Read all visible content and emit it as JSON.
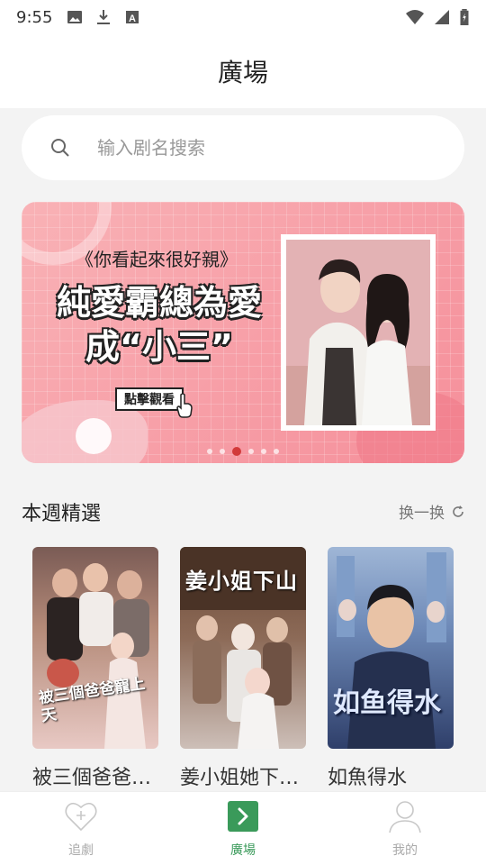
{
  "status_bar": {
    "time": "9:55"
  },
  "header": {
    "title": "廣場"
  },
  "search": {
    "placeholder": "输入剧名搜索"
  },
  "banner": {
    "subtitle": "《你看起來很好親》",
    "headline_line1": "純愛霸總為愛",
    "headline_line2": "成“小三”",
    "cta": "點擊觀看",
    "active_dot_index": 2,
    "dot_count": 6
  },
  "section": {
    "title": "本週精選",
    "refresh_label": "换一换"
  },
  "cards": [
    {
      "title": "被三個爸爸…",
      "poster_text": "被三個爸爸寵上天"
    },
    {
      "title": "姜小姐她下…",
      "poster_text": "姜小姐下山"
    },
    {
      "title": "如魚得水",
      "poster_text": "如鱼得水"
    }
  ],
  "bottom_nav": [
    {
      "label": "追劇",
      "active": false
    },
    {
      "label": "廣場",
      "active": true
    },
    {
      "label": "我的",
      "active": false
    }
  ],
  "colors": {
    "accent_green": "#3a9a5a",
    "banner_pink": "#f7a0a8",
    "active_dot": "#d23a3a"
  }
}
